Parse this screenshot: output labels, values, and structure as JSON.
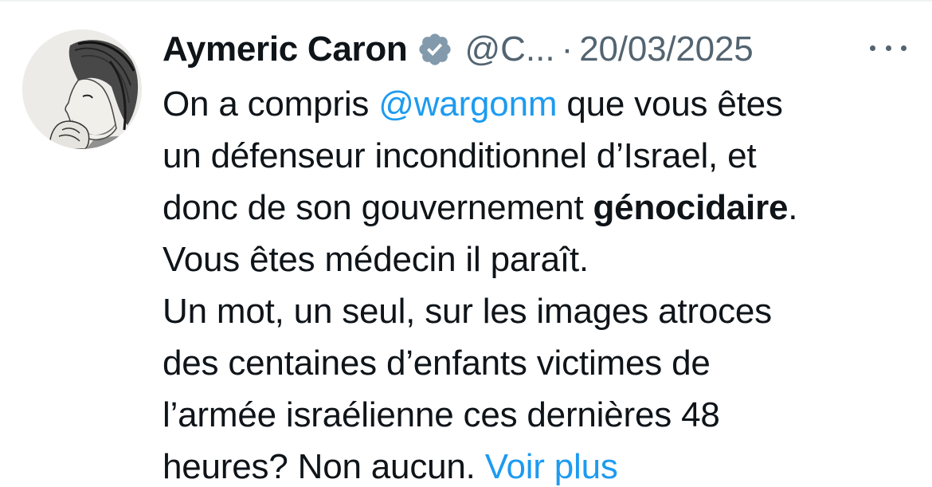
{
  "tweet": {
    "author": {
      "display_name": "Aymeric Caron",
      "handle": "@C...",
      "verified": true,
      "avatar_description": "pencil-sketch-portrait-avatar"
    },
    "separator": "·",
    "date": "20/03/2025",
    "more_icon": "more-horizontal-icon",
    "body": {
      "line1_pre": "On a compris ",
      "mention": "@wargonm",
      "line1_post": " que vous êtes",
      "line2": "un défenseur inconditionnel d’Israel, et",
      "line3_pre": "donc de son gouvernement ",
      "line3_bold": "génocidaire",
      "line3_post": ".",
      "line4": "Vous êtes médecin il paraît.",
      "line5": "Un mot, un seul, sur les images atroces",
      "line6": "des centaines d’enfants victimes de",
      "line7": "l’armée israélienne ces dernières 48",
      "line8_pre": "heures? Non aucun. ",
      "show_more": "Voir plus"
    }
  },
  "colors": {
    "text": "#0f1419",
    "secondary": "#536471",
    "link": "#1d9bf0",
    "verified_badge": "#829aab"
  }
}
